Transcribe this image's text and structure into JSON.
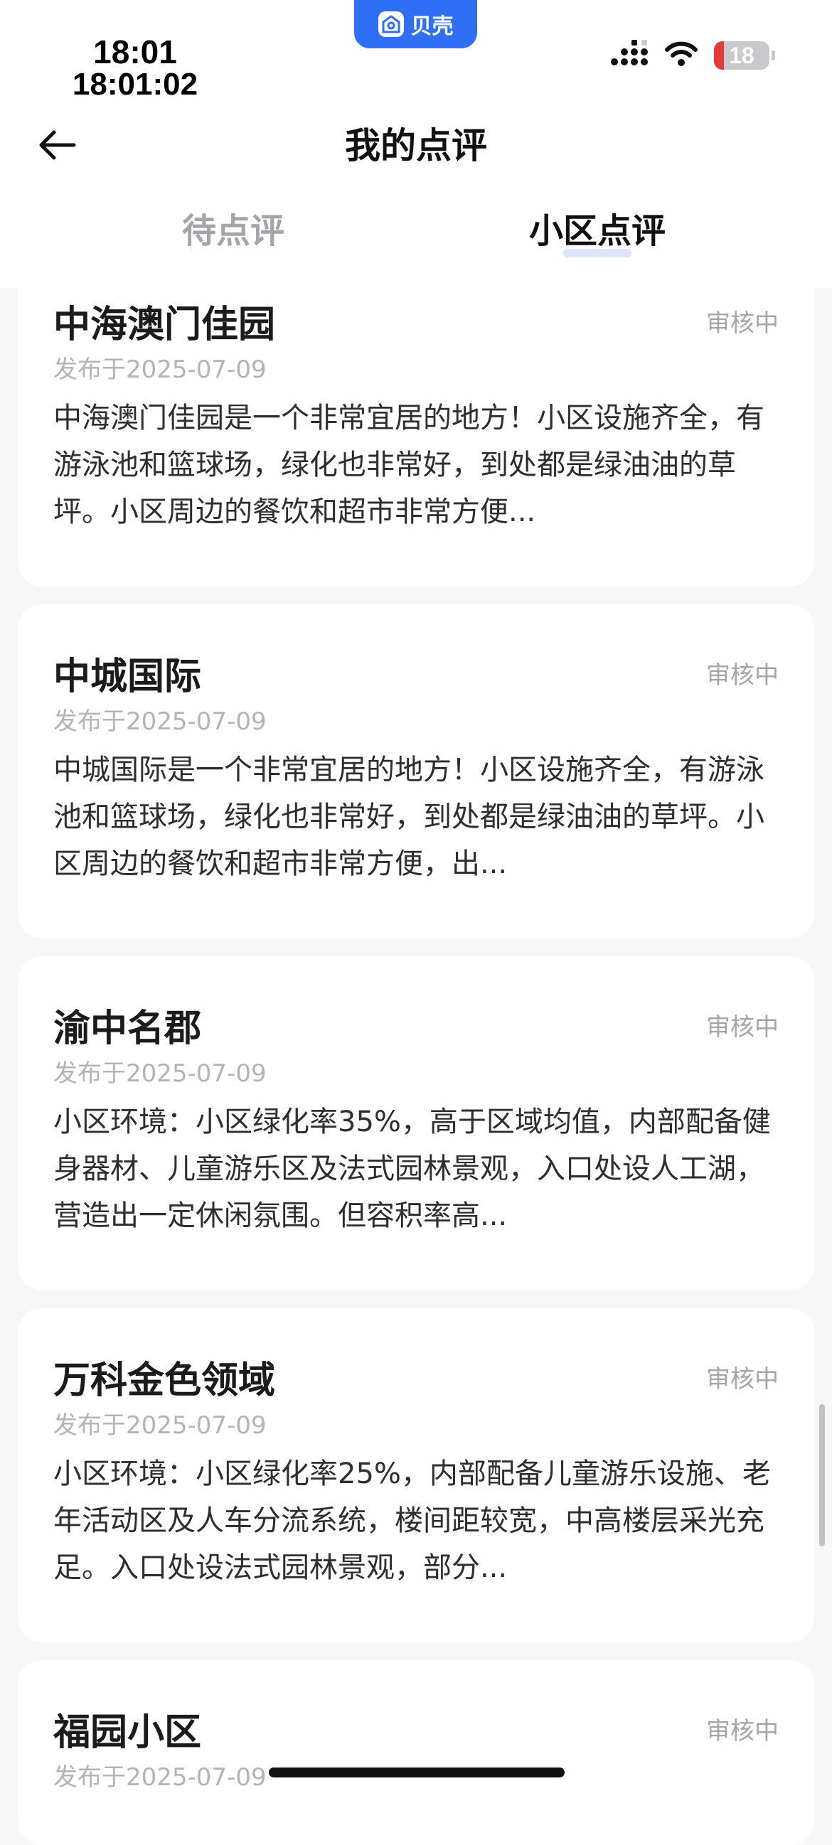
{
  "app_badge": {
    "label": "贝壳",
    "color": "#2f6ff5",
    "icon": "beike-logo-icon"
  },
  "status_bar": {
    "time": "18:01",
    "time_seconds": "18:01:02",
    "battery_level": "18",
    "battery_fraction": 0.18,
    "icons": [
      "cellular-signal-icon",
      "wifi-icon",
      "battery-icon"
    ]
  },
  "nav": {
    "title": "我的点评",
    "back_icon": "back-arrow-icon"
  },
  "tabs": [
    {
      "label": "待点评",
      "selected": false
    },
    {
      "label": "小区点评",
      "selected": true
    }
  ],
  "reviews": [
    {
      "name": "中海澳门佳园",
      "status": "审核中",
      "date": "发布于2025-07-09",
      "content": "中海澳门佳园是一个非常宜居的地方！小区设施齐全，有游泳池和篮球场，绿化也非常好，到处都是绿油油的草坪。小区周边的餐饮和超市非常方便..."
    },
    {
      "name": "中城国际",
      "status": "审核中",
      "date": "发布于2025-07-09",
      "content": "中城国际是一个非常宜居的地方！小区设施齐全，有游泳池和篮球场，绿化也非常好，到处都是绿油油的草坪。小区周边的餐饮和超市非常方便，出..."
    },
    {
      "name": "渝中名郡",
      "status": "审核中",
      "date": "发布于2025-07-09",
      "content": "小区环境：小区绿化率35%，高于区域均值，内部配备健身器材、儿童游乐区及法式园林景观，入口处设人工湖，营造出一定休闲氛围。但容积率高..."
    },
    {
      "name": "万科金色领域",
      "status": "审核中",
      "date": "发布于2025-07-09",
      "content": "小区环境：小区绿化率25%，内部配备儿童游乐设施、老年活动区及人车分流系统，楼间距较宽，中高楼层采光充足。入口处设法式园林景观，部分..."
    },
    {
      "name": "福园小区",
      "status": "审核中",
      "date": "发布于2025-07-09",
      "content": ""
    }
  ]
}
